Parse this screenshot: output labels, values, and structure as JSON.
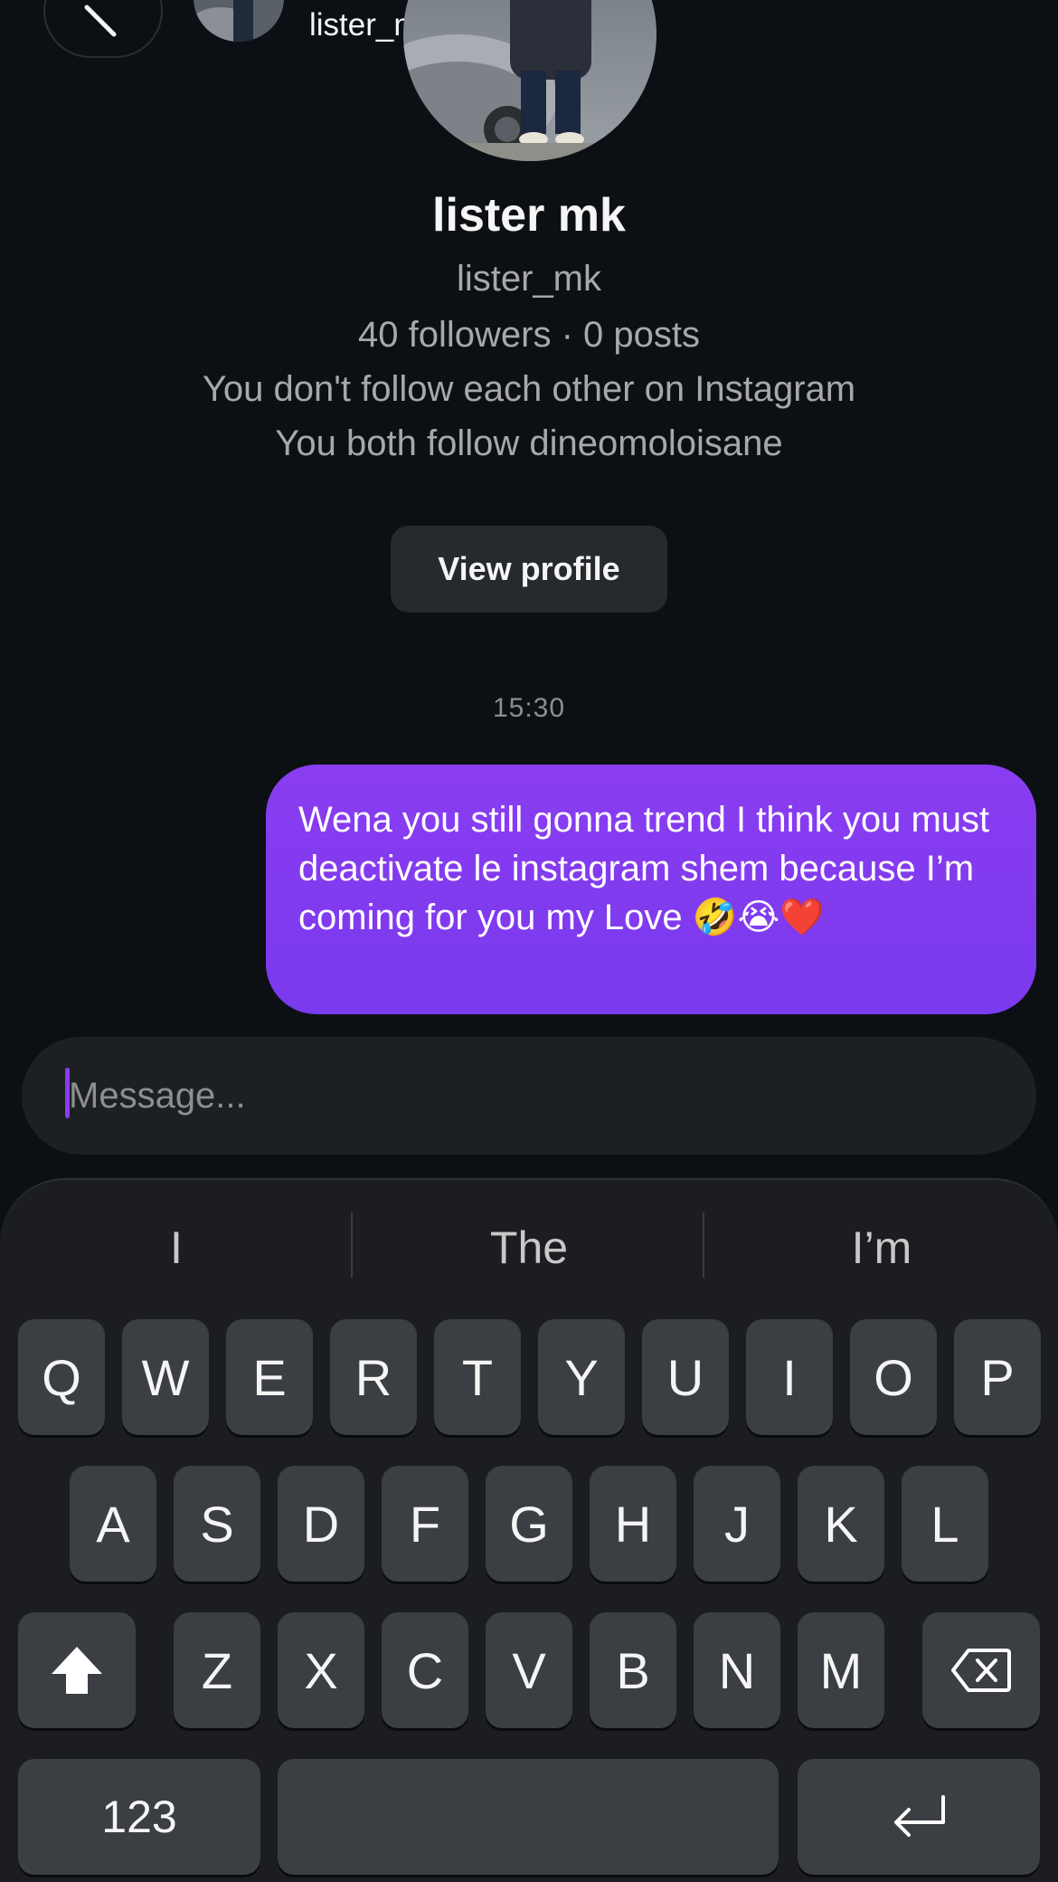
{
  "header": {
    "username": "lister_mk"
  },
  "profile": {
    "display_name": "lister mk",
    "username": "lister_mk",
    "stats": "40 followers · 0 posts",
    "follow_status": "You don't follow each other on Instagram",
    "mutual": "You both follow dineomoloisane",
    "view_profile_label": "View profile"
  },
  "thread": {
    "timestamp": "15:30",
    "messages": [
      {
        "sender": "me",
        "text": "Wena you still gonna trend I think you must deactivate le instagram shem because I’m coming for you my Love 🤣😭❤️"
      }
    ]
  },
  "composer": {
    "placeholder": "Message..."
  },
  "keyboard": {
    "suggestions": [
      "I",
      "The",
      "I’m"
    ],
    "row1": [
      "Q",
      "W",
      "E",
      "R",
      "T",
      "Y",
      "U",
      "I",
      "O",
      "P"
    ],
    "row2": [
      "A",
      "S",
      "D",
      "F",
      "G",
      "H",
      "J",
      "K",
      "L"
    ],
    "row3": [
      "Z",
      "X",
      "C",
      "V",
      "B",
      "N",
      "M"
    ],
    "numbers_label": "123",
    "icons": {
      "shift": "shift-icon",
      "backspace": "backspace-icon",
      "return": "return-icon"
    }
  },
  "colors": {
    "background": "#0c1014",
    "bubble": "#8a3cf0",
    "button": "#262a2f",
    "key": "#3b3e42"
  }
}
